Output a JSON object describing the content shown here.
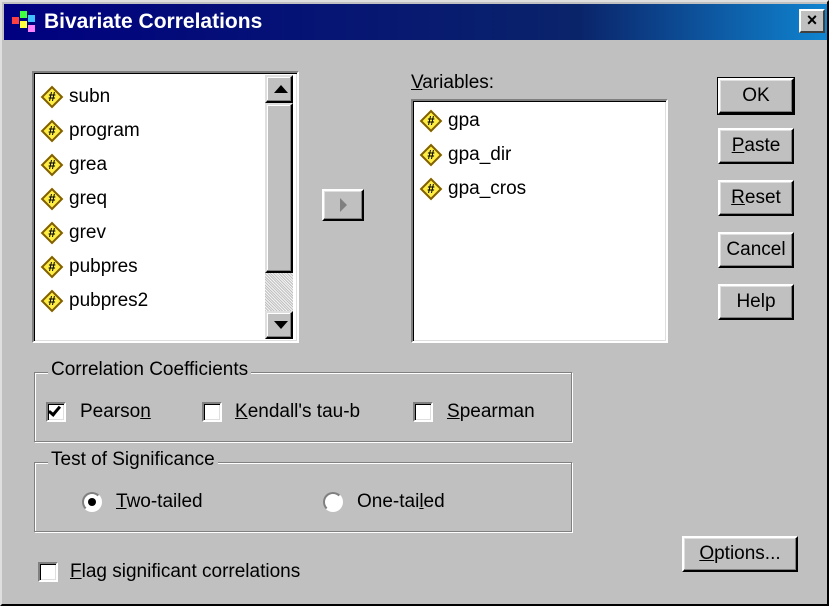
{
  "window": {
    "title": "Bivariate Correlations",
    "close_label": "×"
  },
  "source_list": {
    "items": [
      {
        "label": "subn"
      },
      {
        "label": "program"
      },
      {
        "label": "grea"
      },
      {
        "label": "greq"
      },
      {
        "label": "grev"
      },
      {
        "label": "pubpres"
      },
      {
        "label": "pubpres2"
      }
    ],
    "icon_glyph": "#"
  },
  "variables": {
    "label_underlined": "V",
    "label_rest": "ariables:",
    "items": [
      {
        "label": "gpa"
      },
      {
        "label": "gpa_dir"
      },
      {
        "label": "gpa_cros"
      }
    ]
  },
  "buttons": {
    "ok": "OK",
    "paste_u": "P",
    "paste_rest": "aste",
    "reset_u": "R",
    "reset_rest": "eset",
    "cancel": "Cancel",
    "help": "Help",
    "options_u": "O",
    "options_rest": "ptions..."
  },
  "correlation_coefficients": {
    "group_label": "Correlation Coefficients",
    "pearson_pre": "Pearso",
    "pearson_u": "n",
    "pearson_checked": true,
    "kendall_u": "K",
    "kendall_rest": "endall's tau-b",
    "kendall_checked": false,
    "spearman_u": "S",
    "spearman_rest": "pearman",
    "spearman_checked": false
  },
  "test_of_significance": {
    "group_label": "Test of Significance",
    "two_u": "T",
    "two_rest": "wo-tailed",
    "two_selected": true,
    "one_pre": "One-tai",
    "one_u": "l",
    "one_rest": "ed",
    "one_selected": false
  },
  "flag": {
    "label_u": "F",
    "label_rest": "lag significant correlations",
    "checked": false
  }
}
